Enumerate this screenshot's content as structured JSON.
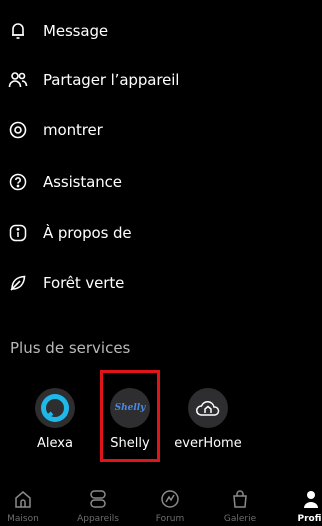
{
  "menu": {
    "items": [
      {
        "label": "Message",
        "icon": "bell-icon"
      },
      {
        "label": "Partager l’appareil",
        "icon": "share-users-icon"
      },
      {
        "label": "montrer",
        "icon": "eye-icon"
      },
      {
        "label": "Assistance",
        "icon": "help-icon"
      },
      {
        "label": "À propos de",
        "icon": "info-icon"
      },
      {
        "label": "Forêt verte",
        "icon": "leaf-icon"
      }
    ]
  },
  "services": {
    "title": "Plus de services",
    "items": [
      {
        "name": "Alexa",
        "icon": "alexa-icon"
      },
      {
        "name": "Shelly",
        "icon": "shelly-logo",
        "logo_text": "Shelly",
        "highlighted": true
      },
      {
        "name": "everHome",
        "icon": "everhome-icon"
      }
    ]
  },
  "tabbar": {
    "tabs": [
      {
        "label": "Maison",
        "icon": "home-icon"
      },
      {
        "label": "Appareils",
        "icon": "devices-icon"
      },
      {
        "label": "Forum",
        "icon": "forum-icon"
      },
      {
        "label": "Galerie",
        "icon": "bag-icon"
      },
      {
        "label": "Profil",
        "icon": "profile-icon",
        "active": true
      }
    ]
  },
  "colors": {
    "background": "#000000",
    "highlight": "#e0151a",
    "alexa": "#1fb8ea",
    "shelly": "#4a8be6"
  }
}
